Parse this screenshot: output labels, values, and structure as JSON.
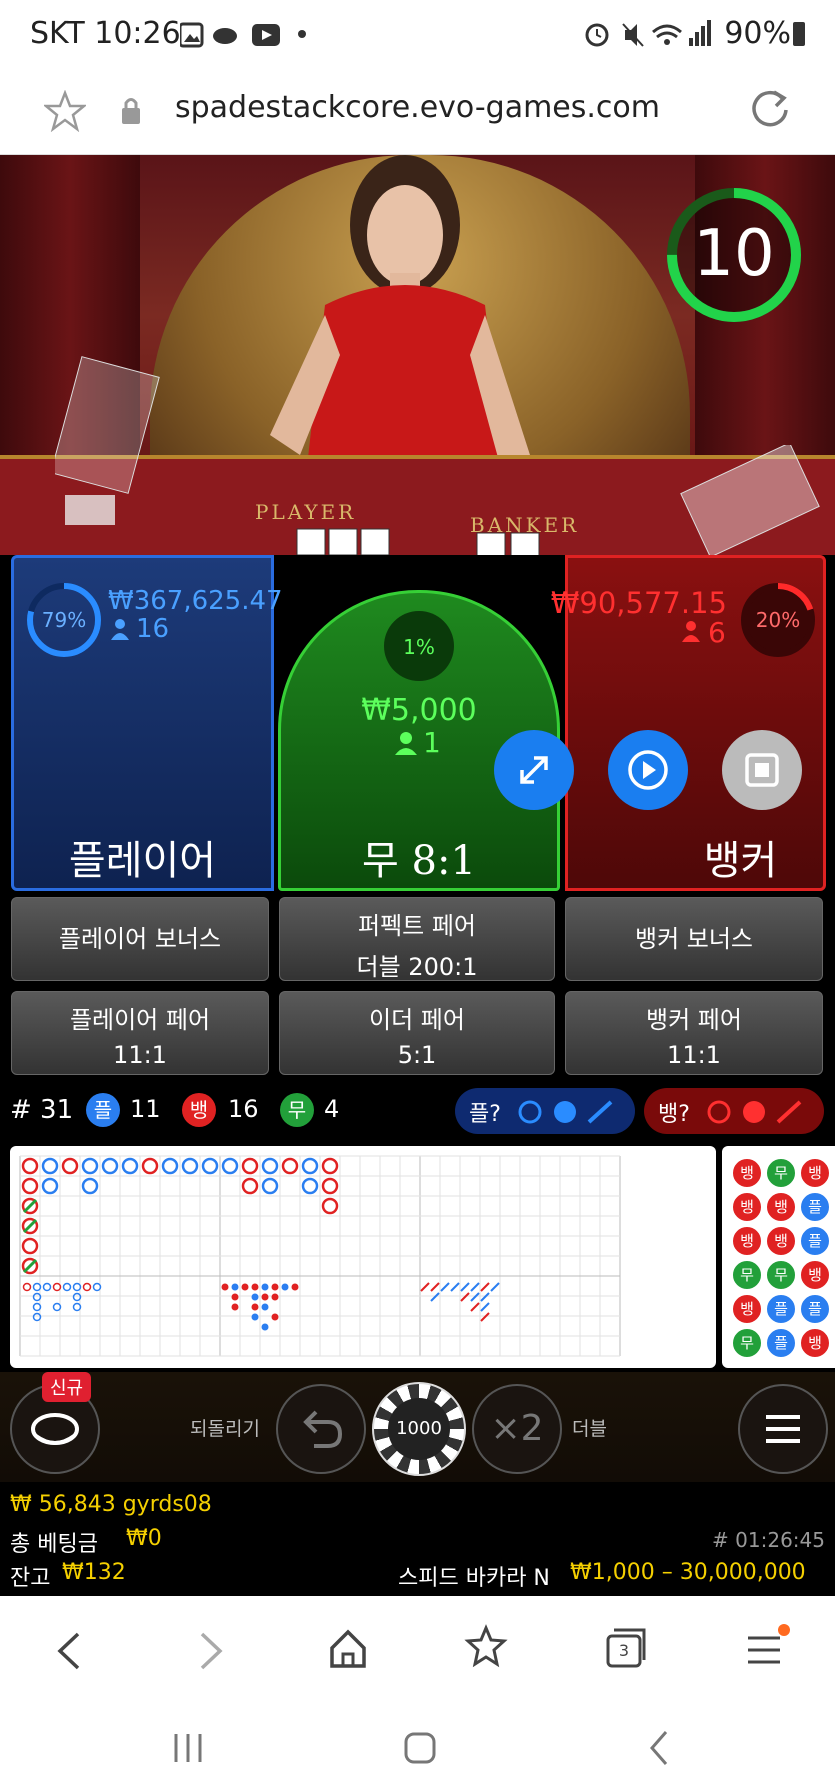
{
  "status_bar": {
    "carrier_time": "SKT 10:26",
    "battery": "90%"
  },
  "browser": {
    "url": "spadestackcore.evo-games.com"
  },
  "timer": {
    "value": "10",
    "progress": 0.75
  },
  "table_labels": {
    "player": "PLAYER",
    "banker": "BANKER"
  },
  "player": {
    "percent": "79%",
    "amount": "₩367,625.47",
    "count": "16",
    "label": "플레이어"
  },
  "tie": {
    "percent": "1%",
    "amount": "₩5,000",
    "count": "1",
    "label": "무 8:1"
  },
  "banker": {
    "percent": "20%",
    "amount": "₩90,577.15",
    "count": "6",
    "label": "뱅커"
  },
  "side_bets": {
    "player_bonus": "플레이어 보너스",
    "perfect_pair_line1": "퍼펙트 페어",
    "perfect_pair_line2": "더블 200:1",
    "banker_bonus": "뱅커 보너스",
    "player_pair_line1": "플레이어 페어",
    "player_pair_line2": "11:1",
    "either_pair_line1": "이더 페어",
    "either_pair_line2": "5:1",
    "banker_pair_line1": "뱅커 페어",
    "banker_pair_line2": "11:1"
  },
  "stats": {
    "round": "# 31",
    "player_badge": "플",
    "player_count": "11",
    "banker_badge": "뱅",
    "banker_count": "16",
    "tie_badge": "무",
    "tie_count": "4",
    "player_predict": "플?",
    "banker_predict": "뱅?"
  },
  "side_road": [
    [
      "뱅",
      "무",
      "뱅"
    ],
    [
      "뱅",
      "뱅",
      "플"
    ],
    [
      "뱅",
      "뱅",
      "플"
    ],
    [
      "무",
      "무",
      "뱅"
    ],
    [
      "뱅",
      "플",
      "플"
    ],
    [
      "무",
      "플",
      "뱅"
    ]
  ],
  "controls": {
    "new_badge": "신규",
    "undo_label": "되돌리기",
    "chip_value": "1000",
    "double_symbol": "×2",
    "double_label": "더블"
  },
  "footer": {
    "balance_user": "₩ 56,843 gyrds08",
    "total_bet_label": "총 베팅금",
    "total_bet_value": "₩0",
    "balance_label": "잔고",
    "balance_value": "₩132",
    "game_id": "# 01:26:45",
    "table_name": "스피드 바카라 N",
    "limits": "₩1,000 – 30,000,000"
  },
  "nav": {
    "tabs_count": "3"
  },
  "colors": {
    "player": "#2a6ce0",
    "banker": "#e02222",
    "tie": "#36d036",
    "accent": "#f5d000"
  }
}
